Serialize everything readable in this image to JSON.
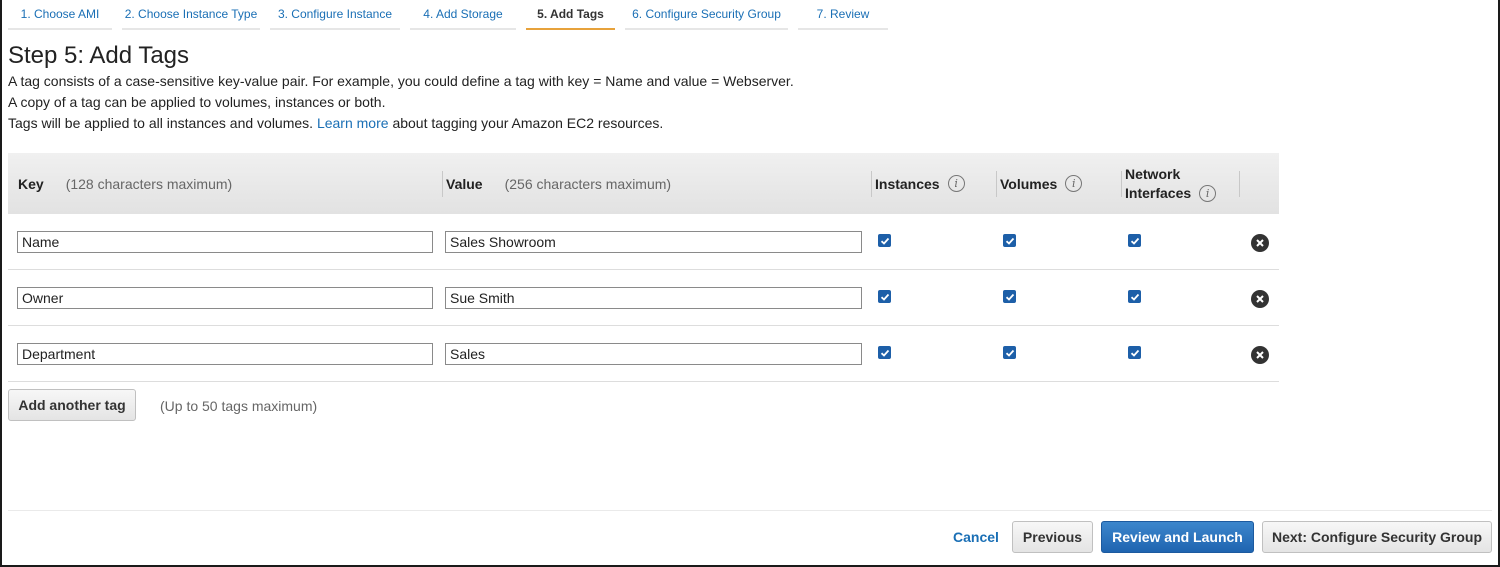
{
  "steps": [
    {
      "label": "1. Choose AMI",
      "active": false
    },
    {
      "label": "2. Choose Instance Type",
      "active": false
    },
    {
      "label": "3. Configure Instance",
      "active": false
    },
    {
      "label": "4. Add Storage",
      "active": false
    },
    {
      "label": "5. Add Tags",
      "active": true
    },
    {
      "label": "6. Configure Security Group",
      "active": false
    },
    {
      "label": "7. Review",
      "active": false
    }
  ],
  "page": {
    "title": "Step 5: Add Tags",
    "desc1": "A tag consists of a case-sensitive key-value pair. For example, you could define a tag with key = Name and value = Webserver.",
    "desc2": "A copy of a tag can be applied to volumes, instances or both.",
    "desc3_pre": "Tags will be applied to all instances and volumes.",
    "desc3_link": "Learn more",
    "desc3_post": "about tagging your Amazon EC2 resources."
  },
  "table": {
    "headers": {
      "key": "Key",
      "key_hint": "(128 characters maximum)",
      "value": "Value",
      "value_hint": "(256 characters maximum)",
      "instances": "Instances",
      "volumes": "Volumes",
      "network_line1": "Network",
      "network_line2": "Interfaces"
    },
    "rows": [
      {
        "key": "Name",
        "value": "Sales Showroom",
        "instances": true,
        "volumes": true,
        "network": true
      },
      {
        "key": "Owner",
        "value": "Sue Smith",
        "instances": true,
        "volumes": true,
        "network": true
      },
      {
        "key": "Department",
        "value": "Sales",
        "instances": true,
        "volumes": true,
        "network": true
      }
    ]
  },
  "add_tag": {
    "label": "Add another tag",
    "note": "(Up to 50 tags maximum)"
  },
  "footer": {
    "cancel": "Cancel",
    "previous": "Previous",
    "review": "Review and Launch",
    "next": "Next: Configure Security Group"
  },
  "colors": {
    "link": "#1a6fb5",
    "active_tab_underline": "#e7a23b",
    "primary_button": "#2470bd",
    "checkbox": "#1d5fa8"
  }
}
